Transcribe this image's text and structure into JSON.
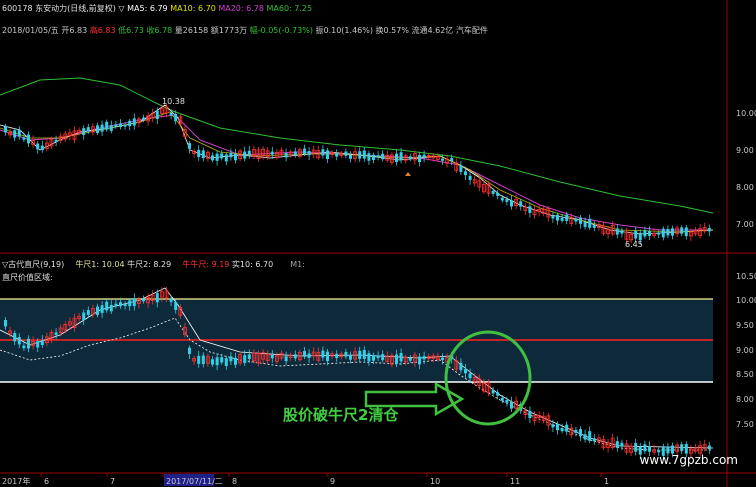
{
  "header": {
    "stock": "600178 东安动力(日线,前复权)",
    "ma_mark": "▽",
    "ma5": "MA5: 6.79",
    "ma10": "MA10: 6.70",
    "ma20": "MA20: 6.78",
    "ma60": "MA60: 7.25"
  },
  "day_info": {
    "date": "2018/01/05/五",
    "open": "开6.83",
    "high": "高6.83",
    "low": "低6.73",
    "close": "收6.78",
    "volume": "量26158",
    "amount": "额1773万",
    "change": "幅-0.05(-0.73%)",
    "amplitude": "振0.10(1.46%)",
    "turnover": "换0.57%",
    "float_cap": "流通4.62亿",
    "sector": "汽车配件"
  },
  "indicator": {
    "name": "▽古代直尺(9,19)",
    "ruler1": "牛尺1: 10.04",
    "ruler2": "牛尺2: 8.29",
    "ruler3": "牛牛尺: 9.19",
    "solid": "实10: 6.70",
    "m": "M1:",
    "zone_label": "直尺价值区域:"
  },
  "annotations": {
    "high_mark": "10.38",
    "low_mark": "6.45",
    "arrow_text": "股价破牛尺2清仓",
    "watermark": "www.7gpzb.com"
  },
  "axes": {
    "upper": [
      "10.00",
      "9.00",
      "8.00",
      "7.00"
    ],
    "lower": [
      "10.50",
      "10.00",
      "9.50",
      "9.00",
      "8.50",
      "8.00",
      "7.50"
    ],
    "dates": [
      "2017年",
      "6",
      "7",
      "2017/07/11/二",
      "8",
      "9",
      "10",
      "11",
      "1"
    ]
  },
  "colors": {
    "up": "#ff3030",
    "down": "#30d0e8",
    "ma5": "#ffffff",
    "ma10": "#e0e000",
    "ma20": "#d040d0",
    "ma60": "#30c030",
    "ruler_upper": "#d0d080",
    "ruler_mid": "#ff2020",
    "ruler_lower": "#ffffff",
    "zone_fill": "#0e2a3a",
    "circle": "#40c040"
  }
}
